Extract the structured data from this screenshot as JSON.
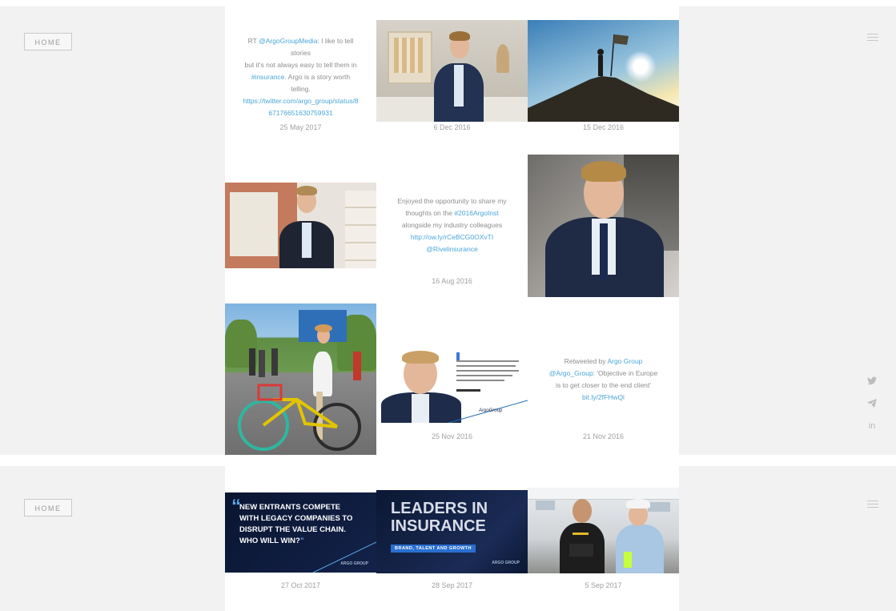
{
  "nav": {
    "home_label": "HOME"
  },
  "icons": {
    "menu": "hamburger-menu-icon",
    "twitter": "twitter-icon",
    "send": "paper-plane-icon",
    "linkedin": "linkedin-icon"
  },
  "social": {
    "linkedin_label": "in"
  },
  "colors": {
    "link": "#4aa6d8",
    "panel_bg": "#f2f2f2",
    "tile_bg": "#ffffff",
    "card_navy": "#0c1730"
  },
  "feed": {
    "tweet1": {
      "lines": [
        {
          "prefix": "RT ",
          "link": "@ArgoGroupMedia",
          "suffix": ": I like to tell stories"
        },
        {
          "prefix": "but it's not always easy to tell them in",
          "link": "",
          "suffix": ""
        },
        {
          "prefix": "",
          "link": "#insurance",
          "suffix": ". Argo is a story worth"
        },
        {
          "prefix": "telling.",
          "link": "",
          "suffix": ""
        },
        {
          "prefix": "",
          "link": "https://twitter.com/argo_group/status/8",
          "suffix": ""
        },
        {
          "prefix": "",
          "link": "67176651630759931",
          "suffix": ""
        }
      ],
      "date": "25 May 2017"
    },
    "photo_portrait_gallery": {
      "date": "6 Dec 2016"
    },
    "photo_mountain": {
      "date": "15 Dec 2016"
    },
    "tweet2": {
      "lines": [
        {
          "prefix": "Enjoyed the opportunity to share my",
          "link": "",
          "suffix": ""
        },
        {
          "prefix": "thoughts on the ",
          "link": "#2016ArgoInst",
          "suffix": ""
        },
        {
          "prefix": "alongside my industry colleagues",
          "link": "",
          "suffix": ""
        },
        {
          "prefix": "",
          "link": "http://ow.ly/rCeBCG0OXvTI",
          "suffix": ""
        },
        {
          "prefix": "",
          "link": "@Rivelinsurance",
          "suffix": ""
        }
      ],
      "date": "16 Aug 2016"
    },
    "quote_card": {
      "date": "25 Nov 2016",
      "brand": "ArgoGroup"
    },
    "tweet3": {
      "lines": [
        {
          "prefix": "Retweeted by ",
          "link": "Argo Group",
          "suffix": ""
        },
        {
          "prefix": "",
          "link": "@Argo_Group",
          "suffix": ": 'Objective in Europe"
        },
        {
          "prefix": "is to get closer to the end client'",
          "link": "",
          "suffix": ""
        },
        {
          "prefix": "",
          "link": "bit.ly/2fFHwQi",
          "suffix": ""
        }
      ],
      "date": "21 Nov 2016"
    },
    "card_new_entrants": {
      "headline": [
        "NEW ENTRANTS COMPETE",
        "WITH LEGACY COMPANIES TO",
        "DISRUPT THE VALUE CHAIN.",
        "WHO WILL WIN?"
      ],
      "brand": "ARGO GROUP",
      "date": "27 Oct 2017"
    },
    "card_leaders": {
      "headline": [
        "LEADERS IN",
        "INSURANCE"
      ],
      "subline": "BRAND, TALENT AND GROWTH",
      "brand": "ARGO GROUP",
      "date": "28 Sep 2017"
    },
    "photo_tent": {
      "date": "5 Sep 2017"
    }
  }
}
